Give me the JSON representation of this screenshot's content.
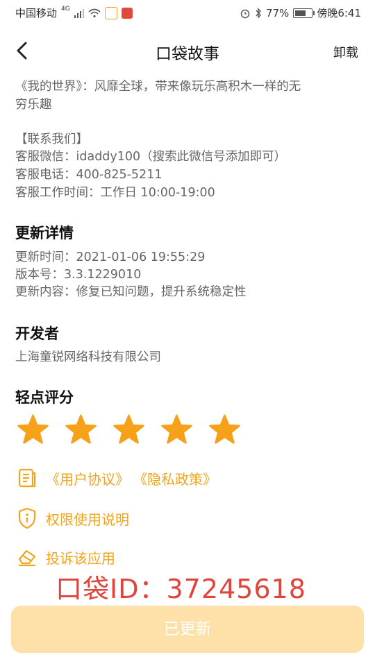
{
  "status_bar": {
    "carrier": "中国移动",
    "network": "4G",
    "battery": "77%",
    "time": "傍晚6:41"
  },
  "header": {
    "title": "口袋故事",
    "uninstall": "卸载"
  },
  "description": {
    "line1": "《我的世界》：风靡全球，带来像玩乐高积木一样的无",
    "line2": "穷乐趣",
    "contact_title": "【联系我们】",
    "wechat": "客服微信：idaddy100（搜索此微信号添加即可）",
    "phone": "客服电话：400-825-5211",
    "hours": "客服工作时间：工作日 10:00-19:00"
  },
  "update": {
    "title": "更新详情",
    "time": "更新时间：2021-01-06 19:55:29",
    "version": "版本号：3.3.1229010",
    "content": "更新内容：修复已知问题，提升系统稳定性"
  },
  "developer": {
    "title": "开发者",
    "name": "上海童锐网络科技有限公司"
  },
  "rating": {
    "title": "轻点评分",
    "stars": 5,
    "color": "#f7a11b"
  },
  "links": {
    "user_agreement": "《用户协议》",
    "privacy_policy": "《隐私政策》",
    "permissions": "权限使用说明",
    "report": "投诉该应用"
  },
  "watermark": "口袋ID：37245618",
  "action_button": "已更新"
}
